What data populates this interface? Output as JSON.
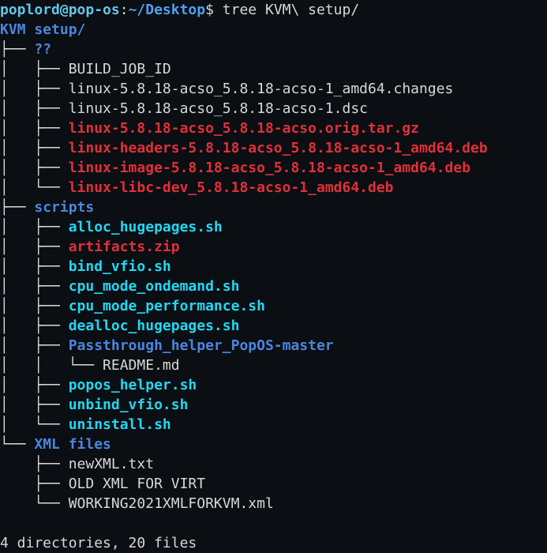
{
  "prompt": {
    "user_host": "poplord@pop-os",
    "separator": ":",
    "path": "~/Desktop",
    "dollar": "$ ",
    "command": "tree KVM\\ setup/"
  },
  "root": "KVM setup/",
  "colors": {
    "background": "#0b0e12",
    "directory": "#4a86e0",
    "executable": "#20d8f4",
    "archive": "#e0303a",
    "plain": "#d8d8d8",
    "prompt_user": "#63c5ea",
    "prompt_path": "#4ea1f1"
  },
  "entries": [
    {
      "prefix": "├── ",
      "name": "??",
      "kind": "dir"
    },
    {
      "prefix": "│   ├── ",
      "name": "BUILD_JOB_ID",
      "kind": "plain"
    },
    {
      "prefix": "│   ├── ",
      "name": "linux-5.8.18-acso_5.8.18-acso-1_amd64.changes",
      "kind": "plain"
    },
    {
      "prefix": "│   ├── ",
      "name": "linux-5.8.18-acso_5.8.18-acso-1.dsc",
      "kind": "plain"
    },
    {
      "prefix": "│   ├── ",
      "name": "linux-5.8.18-acso_5.8.18-acso.orig.tar.gz",
      "kind": "archive"
    },
    {
      "prefix": "│   ├── ",
      "name": "linux-headers-5.8.18-acso_5.8.18-acso-1_amd64.deb",
      "kind": "archive"
    },
    {
      "prefix": "│   ├── ",
      "name": "linux-image-5.8.18-acso_5.8.18-acso-1_amd64.deb",
      "kind": "archive"
    },
    {
      "prefix": "│   └── ",
      "name": "linux-libc-dev_5.8.18-acso-1_amd64.deb",
      "kind": "archive"
    },
    {
      "prefix": "├── ",
      "name": "scripts",
      "kind": "dir"
    },
    {
      "prefix": "│   ├── ",
      "name": "alloc_hugepages.sh",
      "kind": "exec"
    },
    {
      "prefix": "│   ├── ",
      "name": "artifacts.zip",
      "kind": "archive"
    },
    {
      "prefix": "│   ├── ",
      "name": "bind_vfio.sh",
      "kind": "exec"
    },
    {
      "prefix": "│   ├── ",
      "name": "cpu_mode_ondemand.sh",
      "kind": "exec"
    },
    {
      "prefix": "│   ├── ",
      "name": "cpu_mode_performance.sh",
      "kind": "exec"
    },
    {
      "prefix": "│   ├── ",
      "name": "dealloc_hugepages.sh",
      "kind": "exec"
    },
    {
      "prefix": "│   ├── ",
      "name": "Passthrough_helper_PopOS-master",
      "kind": "dir"
    },
    {
      "prefix": "│   │   └── ",
      "name": "README.md",
      "kind": "plain"
    },
    {
      "prefix": "│   ├── ",
      "name": "popos_helper.sh",
      "kind": "exec"
    },
    {
      "prefix": "│   ├── ",
      "name": "unbind_vfio.sh",
      "kind": "exec"
    },
    {
      "prefix": "│   └── ",
      "name": "uninstall.sh",
      "kind": "exec"
    },
    {
      "prefix": "└── ",
      "name": "XML files",
      "kind": "dir"
    },
    {
      "prefix": "    ├── ",
      "name": "newXML.txt",
      "kind": "plain"
    },
    {
      "prefix": "    ├── ",
      "name": "OLD XML FOR VIRT",
      "kind": "plain"
    },
    {
      "prefix": "    └── ",
      "name": "WORKING2021XMLFORKVM.xml",
      "kind": "plain"
    }
  ],
  "summary": "4 directories, 20 files"
}
